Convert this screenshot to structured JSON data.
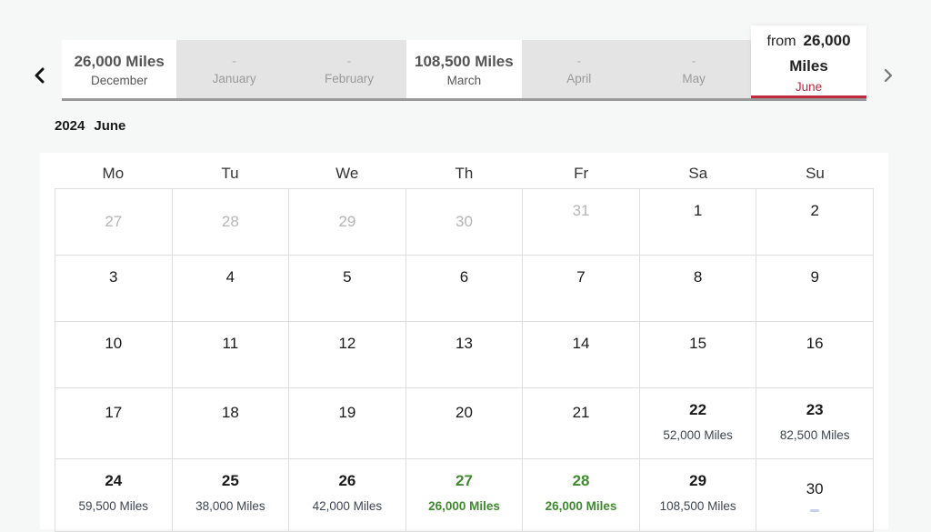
{
  "months": [
    {
      "price": "26,000 Miles",
      "name": "December",
      "available": true
    },
    {
      "price": "-",
      "name": "January",
      "available": false
    },
    {
      "price": "-",
      "name": "February",
      "available": false
    },
    {
      "price": "108,500 Miles",
      "name": "March",
      "available": true
    },
    {
      "price": "-",
      "name": "April",
      "available": false
    },
    {
      "price": "-",
      "name": "May",
      "available": false
    }
  ],
  "selected_month": {
    "from_label": "from",
    "amount": "26,000",
    "unit": "Miles",
    "name": "June"
  },
  "period": {
    "year": "2024",
    "month": "June"
  },
  "weekdays": [
    "Mo",
    "Tu",
    "We",
    "Th",
    "Fr",
    "Sa",
    "Su"
  ],
  "weeks": [
    [
      {
        "day": "27",
        "muted": true
      },
      {
        "day": "28",
        "muted": true
      },
      {
        "day": "29",
        "muted": true
      },
      {
        "day": "30",
        "muted": true
      },
      {
        "day": "31",
        "muted": true
      },
      {
        "day": "1"
      },
      {
        "day": "2"
      }
    ],
    [
      {
        "day": "3"
      },
      {
        "day": "4"
      },
      {
        "day": "5"
      },
      {
        "day": "6"
      },
      {
        "day": "7"
      },
      {
        "day": "8"
      },
      {
        "day": "9"
      }
    ],
    [
      {
        "day": "10"
      },
      {
        "day": "11"
      },
      {
        "day": "12"
      },
      {
        "day": "13"
      },
      {
        "day": "14"
      },
      {
        "day": "15"
      },
      {
        "day": "16"
      }
    ],
    [
      {
        "day": "17"
      },
      {
        "day": "18"
      },
      {
        "day": "19"
      },
      {
        "day": "20"
      },
      {
        "day": "21"
      },
      {
        "day": "22",
        "price": "52,000 Miles"
      },
      {
        "day": "23",
        "price": "82,500 Miles"
      }
    ],
    [
      {
        "day": "24",
        "price": "59,500 Miles"
      },
      {
        "day": "25",
        "price": "38,000 Miles"
      },
      {
        "day": "26",
        "price": "42,000 Miles"
      },
      {
        "day": "27",
        "price": "26,000 Miles",
        "lowest": true
      },
      {
        "day": "28",
        "price": "26,000 Miles",
        "lowest": true
      },
      {
        "day": "29",
        "price": "108,500 Miles"
      },
      {
        "day": "30",
        "loading": true
      }
    ]
  ],
  "colors": {
    "accent": "#c0283e",
    "lowest_price": "#3f8a2e",
    "unavailable_tab": "#e4e4e4"
  },
  "icons": {
    "prev": "chevron-left-icon",
    "next": "chevron-right-icon"
  }
}
